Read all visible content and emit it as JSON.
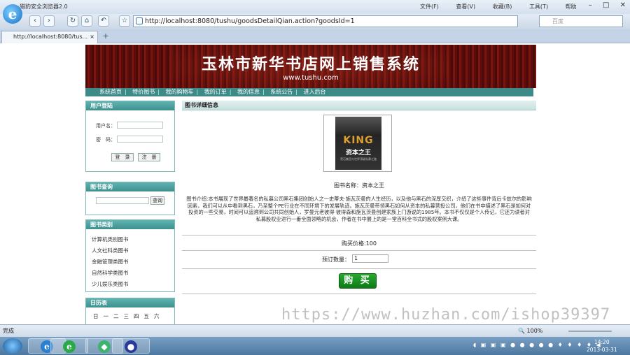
{
  "browser": {
    "title": "猎豹安全浏览器2.0",
    "menu": [
      "文件(F)",
      "查看(V)",
      "收藏(B)",
      "工具(T)",
      "帮助"
    ],
    "address": "http://localhost:8080/tushu/goodsDetailQian.action?goodsId=1",
    "search_placeholder": "百度",
    "tab_label": "http://localhost:8080/tus...",
    "status": "完成",
    "zoom": "100%"
  },
  "site": {
    "banner_title": "玉林市新华书店网上销售系统",
    "banner_url": "www.tushu.com",
    "nav": [
      "系统首页",
      "特价图书",
      "我的购物车",
      "我的订单",
      "我的信息",
      "系统公告",
      "进入后台"
    ]
  },
  "sidebar": {
    "login": {
      "head": "用户登陆",
      "username_label": "用户名：",
      "password_label": "密　码：",
      "login_button": "登　录",
      "register_button": "注　册"
    },
    "search": {
      "head": "图书查询",
      "button": "查询"
    },
    "categories": {
      "head": "图书类别",
      "items": [
        "计算机类别图书",
        "人文社科类图书",
        "金融管理类图书",
        "自然科学类图书",
        "少儿娱乐类图书"
      ]
    },
    "calendar": {
      "head": "日历表",
      "weekdays": [
        "日",
        "一",
        "二",
        "三",
        "四",
        "五",
        "六"
      ]
    }
  },
  "detail": {
    "head": "图书详细信息",
    "cover": {
      "word": "KING",
      "subtitle": "资本之王",
      "tagline": "黑石集团与世界顶级私募之路"
    },
    "book_name": "图书名称：资本之王",
    "description": "图书介绍:本书展现了世界最著名的私募公司黑石集团创始人之一史蒂夫·施瓦茨曼的人生经历，以及他与黑石的深厚交织，介绍了这些事件背后卡兹尔的影响因素，我们可以从中看到黑石，乃至整个PE行业在不同环境下的发展轨迹。施瓦茨曼带领黑石如何从资本的私募营投公司，他们在书中描述了黑石是如何对投资的一些交易，时间可以追溯到公司共同创始人，罗曼元老彼得·彼得森和施瓦茨曼创建家族上门游说的1985年。本书不仅仅是个人传记，它还为读者对私募股权业进行一番全面领略的机会，作者在书中展上的是一堂百科全书式的股权案例大课。",
    "price": "购买价格:100",
    "quantity_label": "预订数量：",
    "quantity_value": "1",
    "buy_button": "购 买"
  },
  "watermark": "https://www.huzhan.com/ishop39397",
  "taskbar": {
    "time": "14:20",
    "date": "2013-03-31"
  }
}
